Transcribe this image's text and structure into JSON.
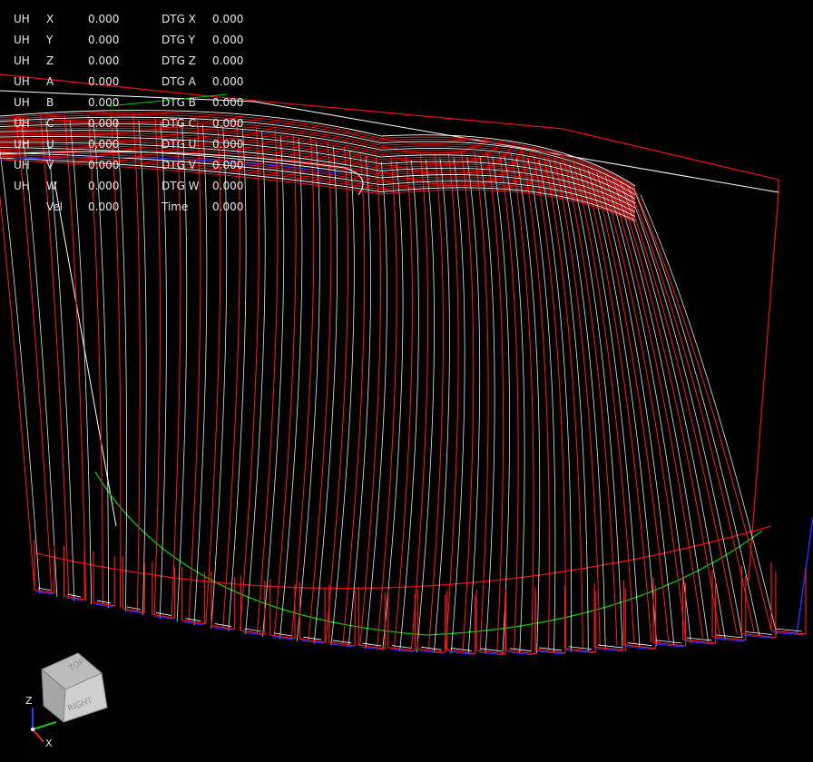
{
  "dro": {
    "rows": [
      {
        "prefix": "UH",
        "axis": "X",
        "value": "0.000",
        "dtg_label": "DTG X",
        "dtg_value": "0.000"
      },
      {
        "prefix": "UH",
        "axis": "Y",
        "value": "0.000",
        "dtg_label": "DTG Y",
        "dtg_value": "0.000"
      },
      {
        "prefix": "UH",
        "axis": "Z",
        "value": "0.000",
        "dtg_label": "DTG Z",
        "dtg_value": "0.000"
      },
      {
        "prefix": "UH",
        "axis": "A",
        "value": "0.000",
        "dtg_label": "DTG A",
        "dtg_value": "0.000"
      },
      {
        "prefix": "UH",
        "axis": "B",
        "value": "0.000",
        "dtg_label": "DTG B",
        "dtg_value": "0.000"
      },
      {
        "prefix": "UH",
        "axis": "C",
        "value": "0.000",
        "dtg_label": "DTG C",
        "dtg_value": "0.000"
      },
      {
        "prefix": "UH",
        "axis": "U",
        "value": "0.000",
        "dtg_label": "DTG U",
        "dtg_value": "0.000"
      },
      {
        "prefix": "UH",
        "axis": "V",
        "value": "0.000",
        "dtg_label": "DTG V",
        "dtg_value": "0.000"
      },
      {
        "prefix": "UH",
        "axis": "W",
        "value": "0.000",
        "dtg_label": "DTG W",
        "dtg_value": "0.000"
      },
      {
        "prefix": "",
        "axis": "Vel",
        "value": "0.000",
        "dtg_label": "Time",
        "dtg_value": "0.000"
      }
    ]
  },
  "view_cube": {
    "top_face": "TOP",
    "front_face": "RIGHT",
    "axes": {
      "z": "Z",
      "x": "X"
    }
  },
  "colors": {
    "background": "#000000",
    "text": "#e8e8e8",
    "feed_path": "#ff1a1a",
    "rapid_path": "#ffffff",
    "arc_path": "#2a2aff",
    "limit_red": "#e01010",
    "limit_white": "#ffffff",
    "limit_green": "#00c800",
    "axis_x": "#e03020",
    "axis_y": "#20c020",
    "axis_z": "#2040ff"
  }
}
